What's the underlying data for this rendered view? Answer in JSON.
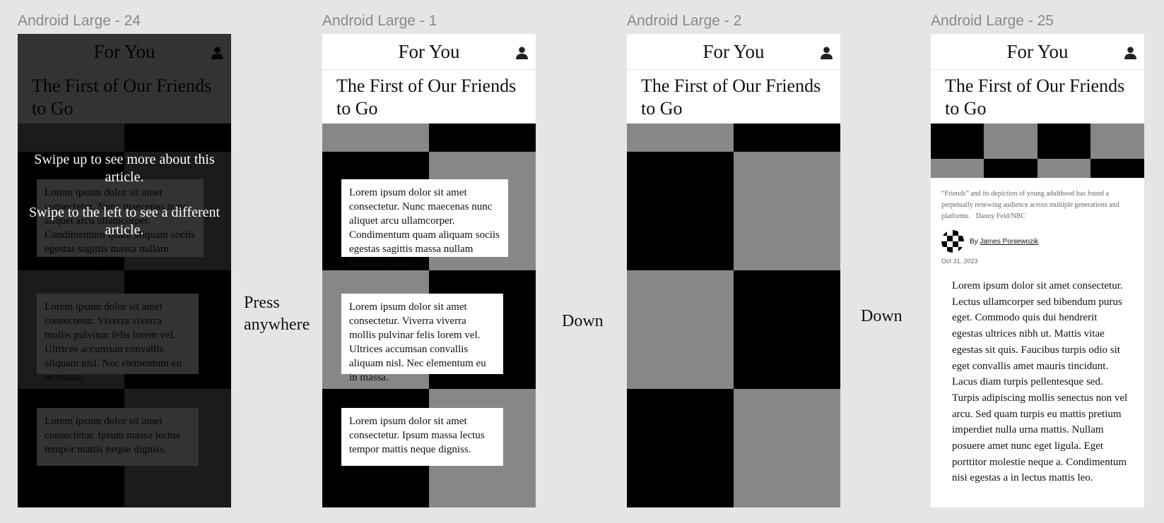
{
  "frames": [
    {
      "label": "Android Large - 24"
    },
    {
      "label": "Android Large - 1"
    },
    {
      "label": "Android Large - 2"
    },
    {
      "label": "Android Large - 25"
    }
  ],
  "app": {
    "title": "For You",
    "headline": "The First of Our Friends to Go",
    "profile_icon": "person-icon"
  },
  "cards": [
    "Lorem ipsum dolor sit amet consectetur. Nunc maecenas nunc aliquet arcu ullamcorper. Condimentum quam aliquam sociis egestas sagittis massa nullam euismod ornare.",
    "Lorem ipsum dolor sit amet consectetur. Viverra viverra mollis pulvinar felis lorem vel. Ultrices accumsan convallis aliquam nisl. Nec elementum eu in massa.",
    "Lorem ipsum dolor sit amet consectetur. Ipsum massa lectus tempor mattis neque digniss."
  ],
  "onboarding": {
    "swipe_up": "Swipe up to see more about this article.",
    "swipe_left": "Swipe to the left to see a different article."
  },
  "steps": [
    "Press anywhere",
    "Down",
    "Down"
  ],
  "article": {
    "caption": "“Friends” and its depiction of young adulthood has found a perpetually renewing audience across multiple generations and platforms.",
    "credit": "Danny Feld/NBC",
    "by": "By",
    "author": "James Poniewozik",
    "date": "Oct 31, 2023",
    "paragraphs": [
      "Lorem ipsum dolor sit amet consectetur. Lectus ullamcorper sed bibendum purus eget. Commodo quis dui hendrerit egestas ultrices nibh ut. Mattis vitae egestas sit quis. Faucibus turpis odio sit eget convallis amet mauris tincidunt.",
      "Lacus diam turpis pellentesque sed. Turpis adipiscing mollis senectus non vel arcu. Sed quam turpis eu mattis pretium imperdiet nulla urna mattis. Nullam posuere amet nunc eget ligula. Eget porttitor molestie neque a. Condimentum nisi egestas a in lectus mattis leo."
    ]
  },
  "colors": {
    "background": "#e5e5e5",
    "black": "#000000",
    "gray": "#878787",
    "overlay": "rgba(0,0,0,0.80)"
  }
}
